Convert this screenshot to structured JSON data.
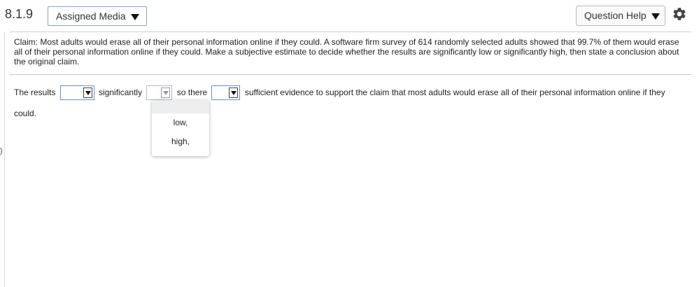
{
  "header": {
    "question_number": "8.1.9",
    "assigned_media_label": "Assigned Media",
    "question_help_label": "Question Help"
  },
  "left_margin_mark": ")",
  "claim_text": "Claim: Most adults would erase all of their personal information online if they could. A software firm survey of 614 randomly selected adults showed that 99.7% of them would erase all of their personal information online if they could. Make a subjective estimate to decide whether the results are significantly low or significantly high, then state a conclusion about the original claim.",
  "answer": {
    "part1": "The results",
    "part2": "significantly",
    "part3": "so there",
    "part4": "sufficient evidence to support the claim that most adults would erase all of their personal information online if they could."
  },
  "dropdown_options": [
    "low,",
    "high,"
  ]
}
